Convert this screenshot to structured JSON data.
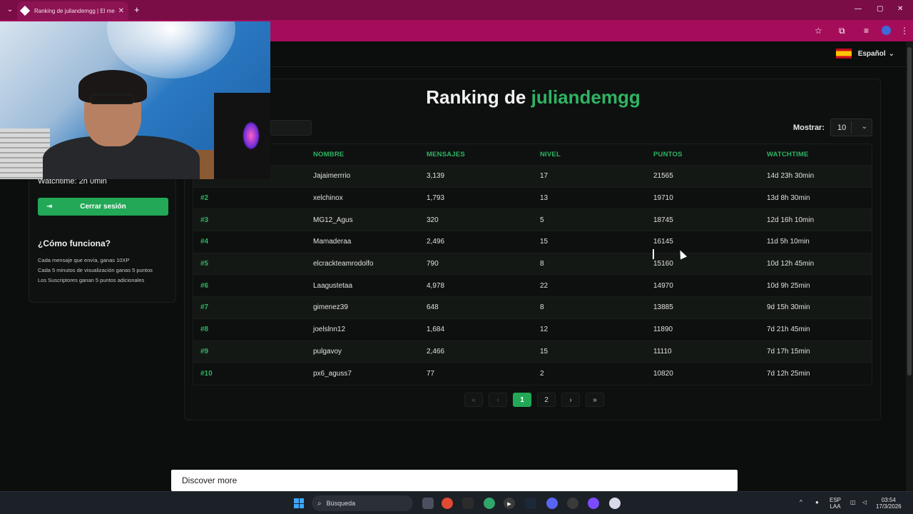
{
  "browser": {
    "tab_title": "Ranking de juliandemgg | El me",
    "tab_close": "✕",
    "new_tab": "+",
    "window_controls": [
      "—",
      "▢",
      "✕"
    ]
  },
  "page": {
    "language": "Español",
    "language_chevron": "⌄",
    "sidebar": {
      "watchtime": "Watchtime: 2h 0min",
      "logout_label": "Cerrar sesión",
      "how_title": "¿Cómo funciona?",
      "how_lines": [
        "Cada mensaje que envía, ganas 10XP",
        "Cada 5 minutos de visualización ganas 5 puntos",
        "Los Suscriptores ganan 5 puntos adicionales"
      ]
    },
    "ranking": {
      "title_prefix": "Ranking de ",
      "title_user": "juliandemgg",
      "show_label": "Mostrar:",
      "show_value": "10",
      "columns": [
        "",
        "NOMBRE",
        "MENSAJES",
        "NIVEL",
        "PUNTOS",
        "WATCHTIME"
      ],
      "rows": [
        [
          "",
          "Jajaimerrrio",
          "3,139",
          "17",
          "21565",
          "14d 23h 30min"
        ],
        [
          "#2",
          "xelchinox",
          "1,793",
          "13",
          "19710",
          "13d 8h 30min"
        ],
        [
          "#3",
          "MG12_Agus",
          "320",
          "5",
          "18745",
          "12d 16h 10min"
        ],
        [
          "#4",
          "Mamaderaa",
          "2,496",
          "15",
          "16145",
          "11d 5h 10min"
        ],
        [
          "#5",
          "elcrackteamrodolfo",
          "790",
          "8",
          "15160",
          "10d 12h 45min"
        ],
        [
          "#6",
          "Laagustetaa",
          "4,978",
          "22",
          "14970",
          "10d 9h 25min"
        ],
        [
          "#7",
          "gimenez39",
          "648",
          "8",
          "13885",
          "9d 15h 30min"
        ],
        [
          "#8",
          "joelslnn12",
          "1,684",
          "12",
          "11890",
          "7d 21h 45min"
        ],
        [
          "#9",
          "pulgavoy",
          "2,466",
          "15",
          "11110",
          "7d 17h 15min"
        ],
        [
          "#10",
          "px6_aguss7",
          "77",
          "2",
          "10820",
          "7d 12h 25min"
        ]
      ],
      "pager": {
        "first": "«",
        "prev": "‹",
        "pages": [
          "1",
          "2"
        ],
        "active_page": "1",
        "next": "›",
        "last": "»"
      }
    },
    "discover": "Discover more"
  },
  "taskbar": {
    "search_placeholder": "Búsqueda",
    "lang_top": "ESP",
    "lang_bottom": "LAA",
    "time": "03:54",
    "date": "17/3/2026"
  }
}
